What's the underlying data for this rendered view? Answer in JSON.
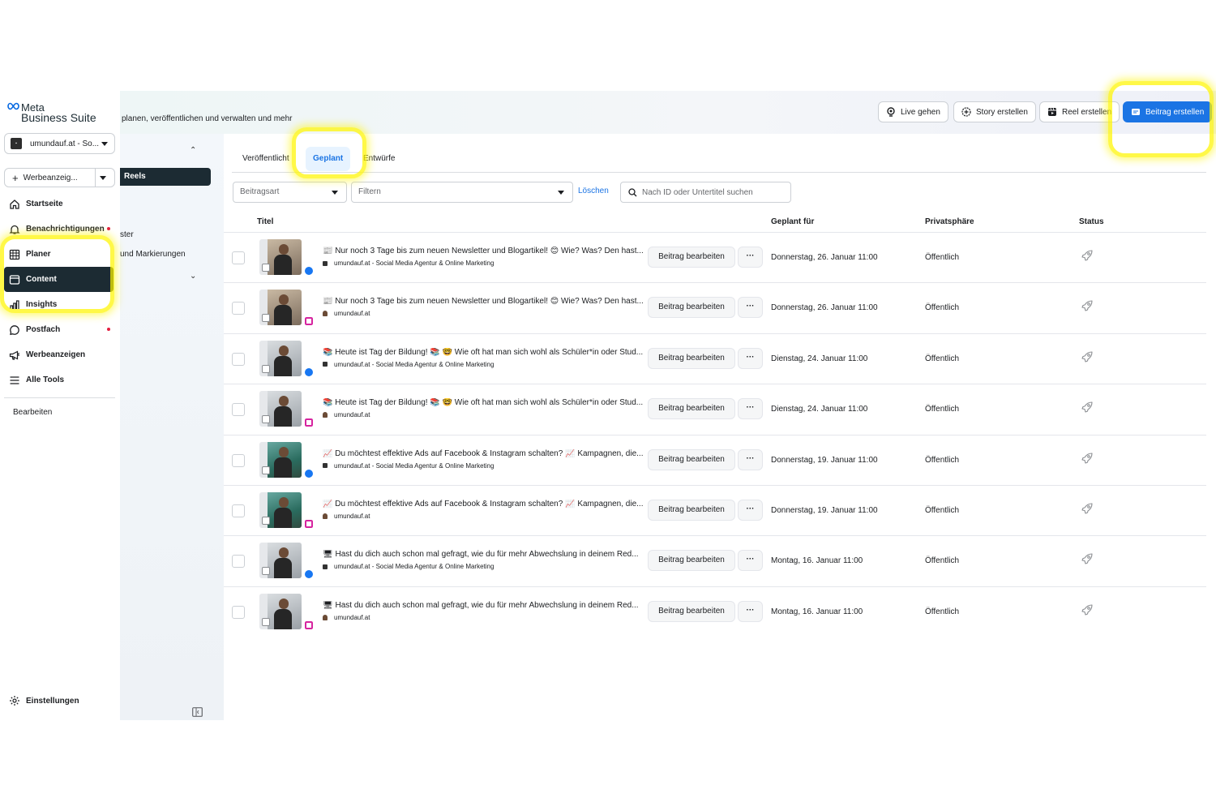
{
  "brand": {
    "line1": "Meta",
    "line2": "Business Suite",
    "accent": "#1b74e4"
  },
  "account": {
    "name": "umundauf.at - So..."
  },
  "ad_button": {
    "label": "Werbeanzeig..."
  },
  "nav": {
    "items": [
      {
        "label": "Startseite",
        "icon": "home-icon",
        "dot": false
      },
      {
        "label": "Benachrichtigungen",
        "icon": "bell-icon",
        "dot": true
      },
      {
        "label": "Planer",
        "icon": "calendar-grid-icon",
        "dot": false
      },
      {
        "label": "Content",
        "icon": "content-icon",
        "dot": false,
        "active": true
      },
      {
        "label": "Insights",
        "icon": "bar-chart-icon",
        "dot": false
      },
      {
        "label": "Postfach",
        "icon": "chat-bubble-icon",
        "dot": true
      },
      {
        "label": "Werbeanzeigen",
        "icon": "megaphone-icon",
        "dot": false
      },
      {
        "label": "Alle Tools",
        "icon": "menu-icon",
        "dot": false
      }
    ],
    "edit_label": "Bearbeiten",
    "settings_label": "Einstellungen"
  },
  "header": {
    "description": "planen, veröffentlichen und verwalten und mehr",
    "buttons": {
      "live": "Live gehen",
      "story": "Story erstellen",
      "reel": "Reel erstellen",
      "post": "Beitrag erstellen"
    }
  },
  "subnav": {
    "reels": "Reels",
    "item_a": "ster",
    "item_b": "und Markierungen"
  },
  "tabs": {
    "published": "Veröffentlicht",
    "planned": "Geplant",
    "drafts": "Entwürfe"
  },
  "filters": {
    "post_type": "Beitragsart",
    "filter": "Filtern",
    "clear": "Löschen",
    "search_placeholder": "Nach ID oder Untertitel suchen"
  },
  "table": {
    "headers": {
      "title": "Titel",
      "scheduled": "Geplant für",
      "privacy": "Privatsphäre",
      "status": "Status"
    },
    "edit_label": "Beitrag bearbeiten",
    "more_label": "···",
    "rows": [
      {
        "title": "📰 Nur noch 3 Tage bis zum neuen Newsletter und Blogartikel! 😊 Wie? Was? Den hast...",
        "account": "umundauf.at - Social Media Agentur & Online Marketing",
        "platform": "facebook",
        "date": "Donnerstag, 26. Januar 11:00",
        "privacy": "Öffentlich"
      },
      {
        "title": "📰 Nur noch 3 Tage bis zum neuen Newsletter und Blogartikel! 😊 Wie? Was? Den hast...",
        "account": "umundauf.at",
        "platform": "instagram",
        "date": "Donnerstag, 26. Januar 11:00",
        "privacy": "Öffentlich"
      },
      {
        "title": "📚 Heute ist Tag der Bildung! 📚 🤓 Wie oft hat man sich wohl als Schüler*in oder Stud...",
        "account": "umundauf.at - Social Media Agentur & Online Marketing",
        "platform": "facebook",
        "date": "Dienstag, 24. Januar 11:00",
        "privacy": "Öffentlich"
      },
      {
        "title": "📚 Heute ist Tag der Bildung! 📚 🤓 Wie oft hat man sich wohl als Schüler*in oder Stud...",
        "account": "umundauf.at",
        "platform": "instagram",
        "date": "Dienstag, 24. Januar 11:00",
        "privacy": "Öffentlich"
      },
      {
        "title": "📈 Du möchtest effektive Ads auf Facebook & Instagram schalten? 📈 Kampagnen, die...",
        "account": "umundauf.at - Social Media Agentur & Online Marketing",
        "platform": "facebook",
        "date": "Donnerstag, 19. Januar 11:00",
        "privacy": "Öffentlich"
      },
      {
        "title": "📈 Du möchtest effektive Ads auf Facebook & Instagram schalten? 📈 Kampagnen, die...",
        "account": "umundauf.at",
        "platform": "instagram",
        "date": "Donnerstag, 19. Januar 11:00",
        "privacy": "Öffentlich"
      },
      {
        "title": "🖥 Hast du dich auch schon mal gefragt, wie du für mehr Abwechslung in deinem Red...",
        "account": "umundauf.at - Social Media Agentur & Online Marketing",
        "platform": "facebook",
        "date": "Montag, 16. Januar 11:00",
        "privacy": "Öffentlich"
      },
      {
        "title": "🖥 Hast du dich auch schon mal gefragt, wie du für mehr Abwechslung in deinem Red...",
        "account": "umundauf.at",
        "platform": "instagram",
        "date": "Montag, 16. Januar 11:00",
        "privacy": "Öffentlich"
      }
    ]
  }
}
